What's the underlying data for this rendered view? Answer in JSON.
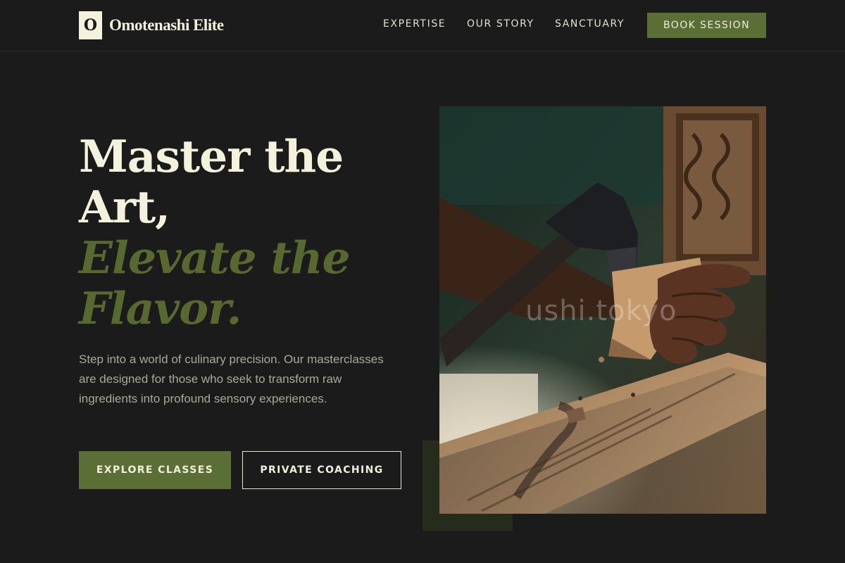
{
  "header": {
    "logo_letter": "O",
    "brand": "Omotenashi Elite",
    "nav": [
      {
        "label": "EXPERTISE"
      },
      {
        "label": "OUR STORY"
      },
      {
        "label": "SANCTUARY"
      }
    ],
    "cta_label": "BOOK SESSION"
  },
  "hero": {
    "title_line1": "Master the",
    "title_line2": "Art,",
    "title_accent_line1": "Elevate the",
    "title_accent_line2": "Flavor.",
    "description": "Step into a world of culinary precision. Our masterclasses are designed for those who seek to transform raw ingredients into profound sensory experiences.",
    "primary_button": "EXPLORE CLASSES",
    "secondary_button": "PRIVATE COACHING"
  },
  "image": {
    "subject": "hand-holding-adze-carving-wood",
    "watermark": "ushi.tokyo"
  },
  "colors": {
    "background": "#1b1b1b",
    "accent_green": "#5b6e35",
    "cream": "#f4f1dc",
    "muted_text": "#a8a89b"
  }
}
